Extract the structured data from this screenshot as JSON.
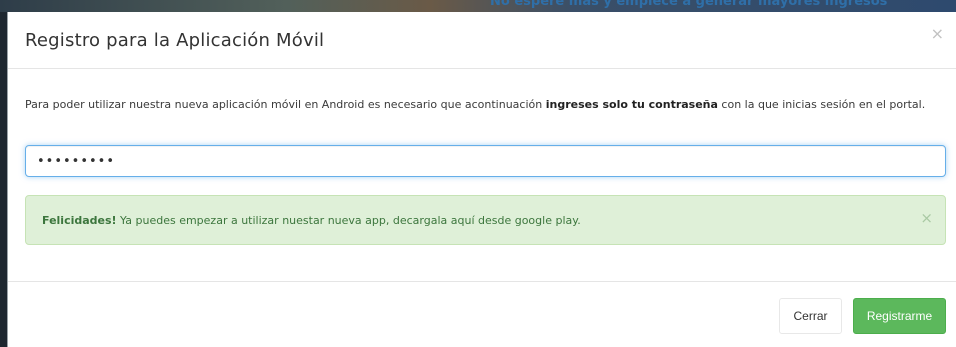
{
  "background": {
    "partial_text": "No espere más y empiece a generar mayores ingresos"
  },
  "modal": {
    "title": "Registro para la Aplicación Móvil",
    "close_label": "×",
    "body": {
      "intro_before": "Para poder utilizar nuestra nueva aplicación móvil en Android es necesario que acontinuación ",
      "intro_bold": "ingreses solo tu contraseña",
      "intro_after": " con la que inicias sesión en el portal."
    },
    "password_field": {
      "value": "•••••••••",
      "type": "password"
    },
    "alert": {
      "bold": "Felicidades!",
      "text": " Ya puedes empezar a utilizar nuestar nueva app, decargala aquí desde google play.",
      "close_label": "×"
    },
    "footer": {
      "cancel_label": "Cerrar",
      "submit_label": "Registrarme"
    }
  },
  "colors": {
    "success_bg": "#dff0d8",
    "success_text": "#3c763d",
    "primary_button": "#5cb85c",
    "input_focus": "#66afe9"
  }
}
